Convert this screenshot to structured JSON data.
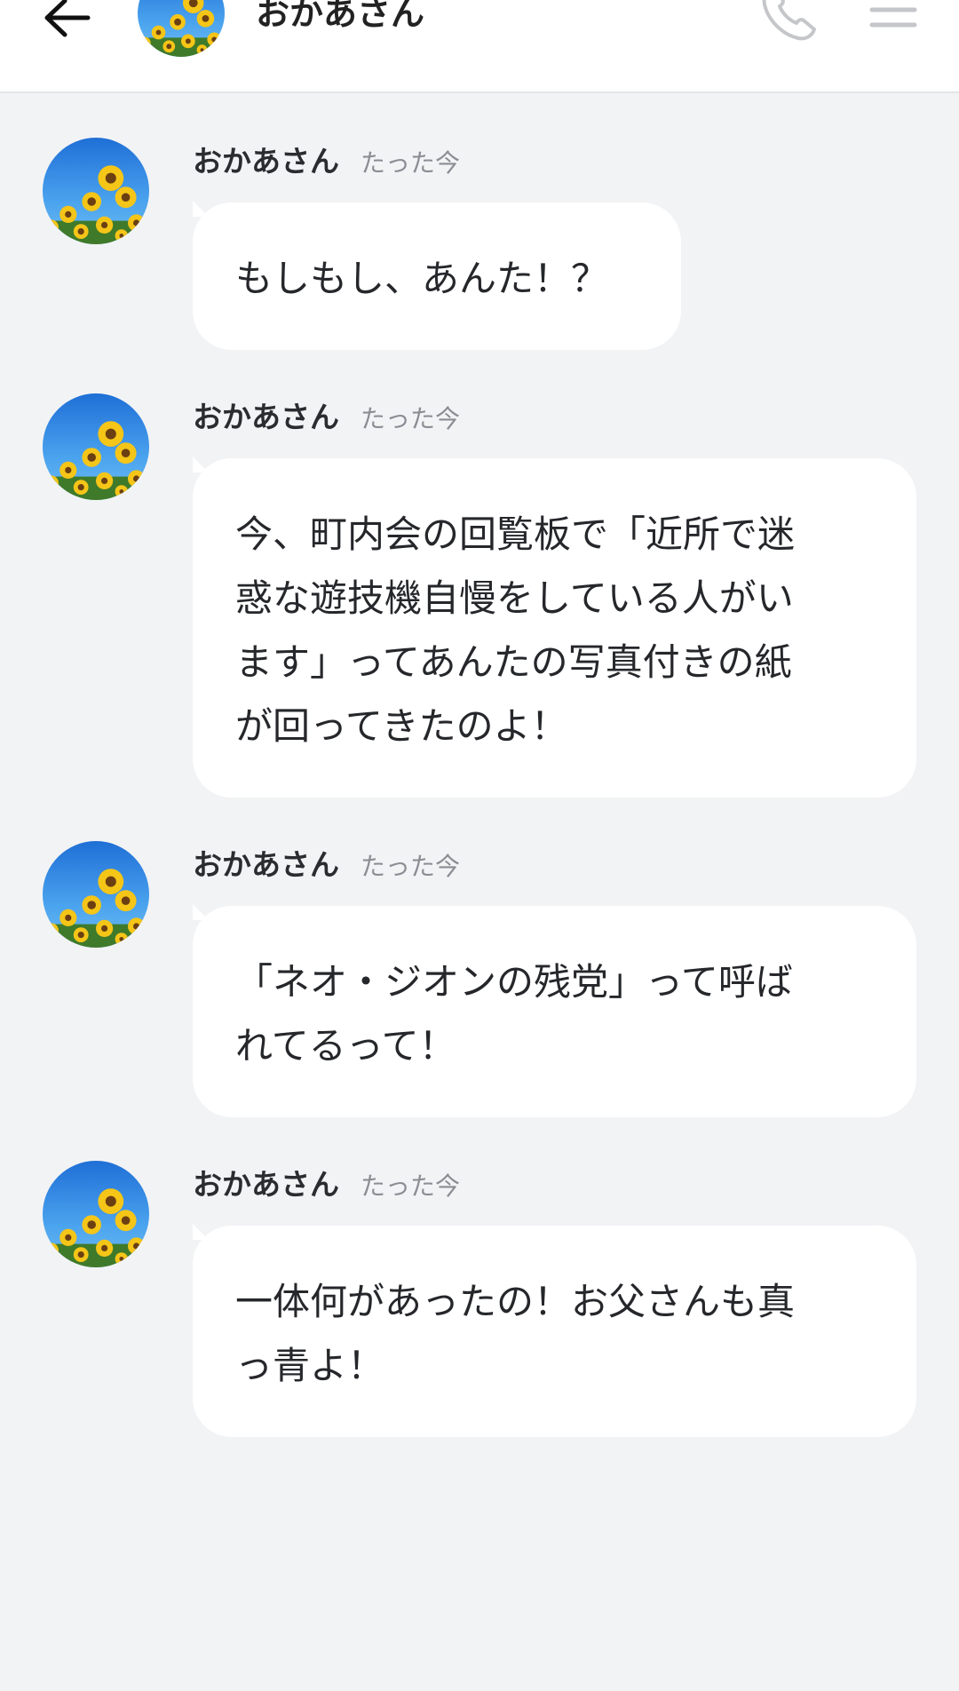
{
  "header": {
    "title": "おかあさん",
    "back_icon": "arrow-left-icon",
    "call_icon": "phone-icon",
    "menu_icon": "hamburger-menu-icon"
  },
  "colors": {
    "background": "#f2f3f5",
    "bubble": "#ffffff",
    "header_icon_gray": "#c4c6ca"
  },
  "messages": [
    {
      "sender": "おかあさん",
      "time": "たった今",
      "text": "もしもし、あんた！？"
    },
    {
      "sender": "おかあさん",
      "time": "たった今",
      "text": "今、町内会の回覧板で「近所で迷\n惑な遊技機自慢をしている人がい\nます」ってあんたの写真付きの紙\nが回ってきたのよ！"
    },
    {
      "sender": "おかあさん",
      "time": "たった今",
      "text": "「ネオ・ジオンの残党」って呼ば\nれてるって！"
    },
    {
      "sender": "おかあさん",
      "time": "たった今",
      "text": "一体何があったの！お父さんも真\nっ青よ！"
    }
  ]
}
